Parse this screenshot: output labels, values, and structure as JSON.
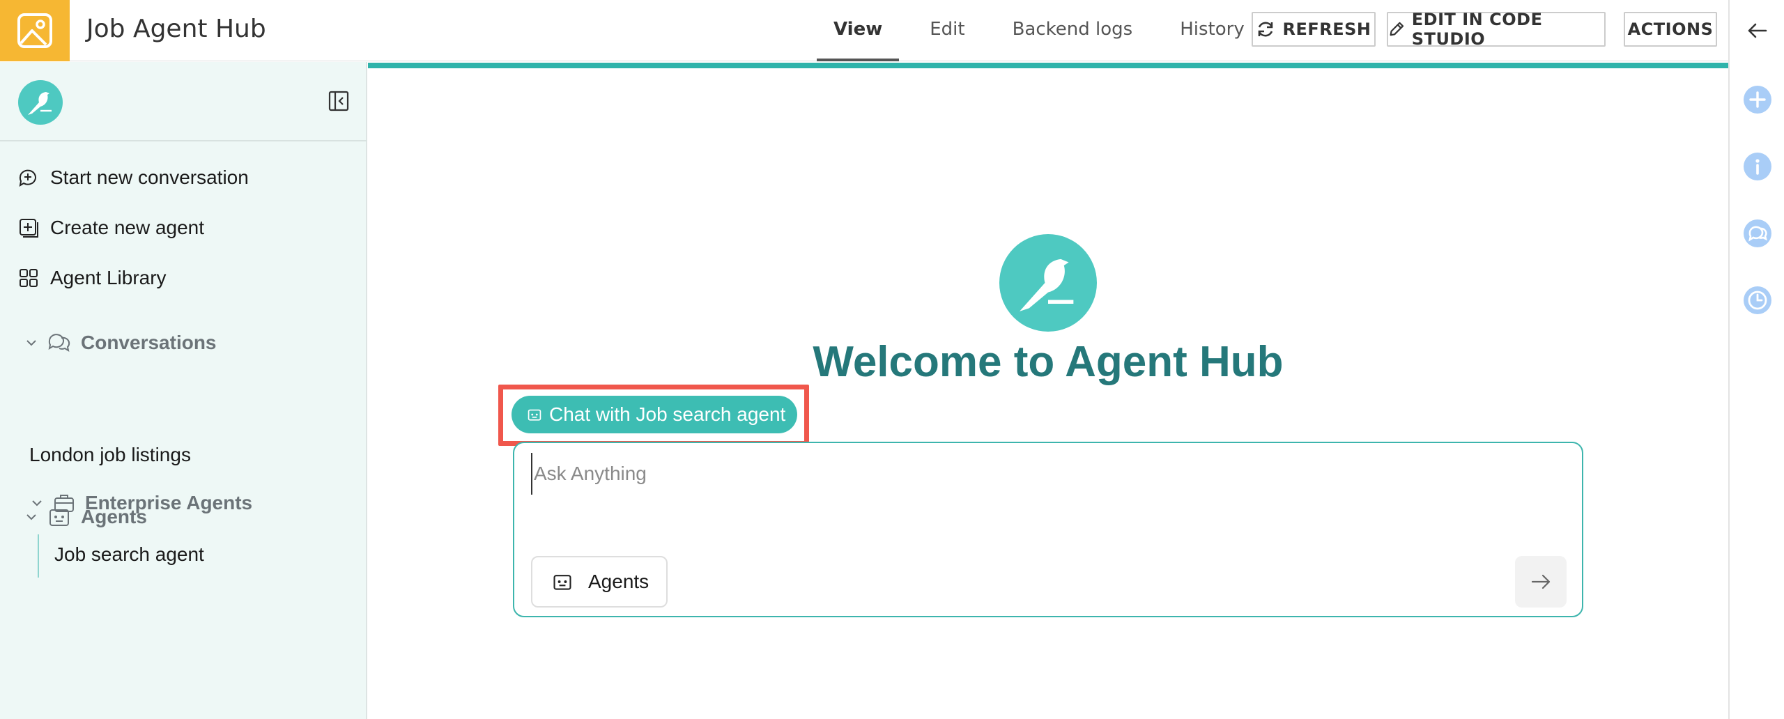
{
  "header": {
    "title": "Job Agent Hub",
    "logo_icon": "image-icon",
    "tabs": [
      {
        "label": "View",
        "active": true
      },
      {
        "label": "Edit",
        "active": false
      },
      {
        "label": "Backend logs",
        "active": false
      },
      {
        "label": "History",
        "active": false
      }
    ],
    "buttons": {
      "refresh": "REFRESH",
      "code_studio": "EDIT IN CODE STUDIO",
      "actions": "ACTIONS"
    },
    "accent_color": "#f6b733"
  },
  "sidebar": {
    "actions": [
      {
        "label": "Start new conversation",
        "icon": "new-chat-icon"
      },
      {
        "label": "Create new agent",
        "icon": "add-box-icon"
      },
      {
        "label": "Agent Library",
        "icon": "grid-icon"
      }
    ],
    "conversations": {
      "label": "Conversations",
      "items": [
        "London job listings"
      ]
    },
    "agents": {
      "label": "Agents",
      "enterprise": {
        "label": "Enterprise Agents",
        "items": [
          "Job search agent"
        ]
      }
    }
  },
  "main": {
    "welcome": "Welcome to Agent Hub",
    "agent_chip": "Chat with Job search agent",
    "chat": {
      "placeholder": "Ask Anything",
      "agents_button": "Agents"
    },
    "brand_color": "#4ec9c1",
    "highlight_color": "#f0574c"
  },
  "right_rail": {
    "icons": [
      "back-arrow-icon",
      "plus-circle-icon",
      "info-icon",
      "chat-bubbles-icon",
      "clock-icon"
    ]
  }
}
